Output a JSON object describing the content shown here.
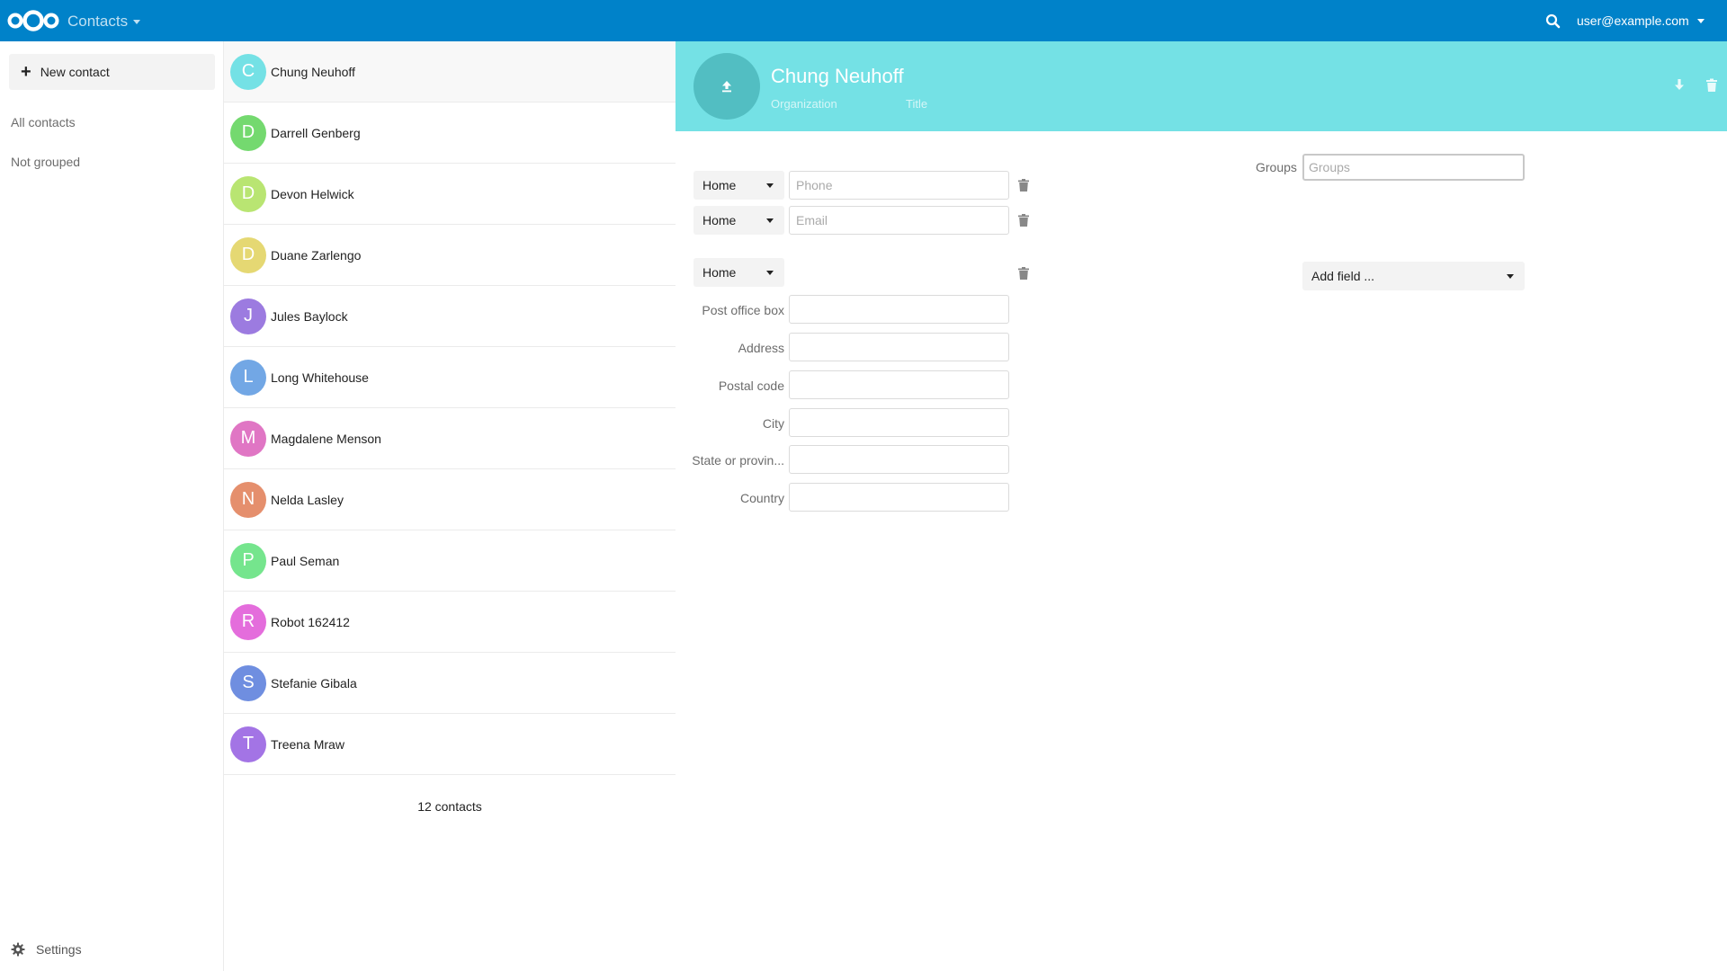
{
  "header": {
    "app_title": "Contacts",
    "user": "user@example.com",
    "brand_color": "#0082c9"
  },
  "nav": {
    "new_contact": "New contact",
    "items": [
      "All contacts",
      "Not grouped"
    ],
    "settings": "Settings"
  },
  "contacts": [
    {
      "initial": "C",
      "name": "Chung Neuhoff",
      "color": "#74e1e5"
    },
    {
      "initial": "D",
      "name": "Darrell Genberg",
      "color": "#74d96f"
    },
    {
      "initial": "D",
      "name": "Devon Helwick",
      "color": "#b9e572"
    },
    {
      "initial": "D",
      "name": "Duane Zarlengo",
      "color": "#e5d873"
    },
    {
      "initial": "J",
      "name": "Jules Baylock",
      "color": "#9c7be0"
    },
    {
      "initial": "L",
      "name": "Long Whitehouse",
      "color": "#72a7e5"
    },
    {
      "initial": "M",
      "name": "Magdalene Menson",
      "color": "#e076c4"
    },
    {
      "initial": "N",
      "name": "Nelda Lasley",
      "color": "#e58f6d"
    },
    {
      "initial": "P",
      "name": "Paul Seman",
      "color": "#75e58d"
    },
    {
      "initial": "R",
      "name": "Robot 162412",
      "color": "#e46ddc"
    },
    {
      "initial": "S",
      "name": "Stefanie Gibala",
      "color": "#6f8ee0"
    },
    {
      "initial": "T",
      "name": "Treena Mraw",
      "color": "#a374e5"
    }
  ],
  "count_label": "12 contacts",
  "detail": {
    "name": "Chung Neuhoff",
    "organization_placeholder": "Organization",
    "title_placeholder": "Title",
    "header_color": "#74e1e5",
    "phone": {
      "type": "Home",
      "placeholder": "Phone",
      "value": ""
    },
    "email": {
      "type": "Home",
      "placeholder": "Email",
      "value": ""
    },
    "address": {
      "type": "Home",
      "fields": [
        {
          "label": "Post office box",
          "value": ""
        },
        {
          "label": "Address",
          "value": ""
        },
        {
          "label": "Postal code",
          "value": ""
        },
        {
          "label": "City",
          "value": ""
        },
        {
          "label": "State or provin...",
          "value": ""
        },
        {
          "label": "Country",
          "value": ""
        }
      ]
    },
    "groups_label": "Groups",
    "groups_placeholder": "Groups",
    "add_field": "Add field ..."
  }
}
